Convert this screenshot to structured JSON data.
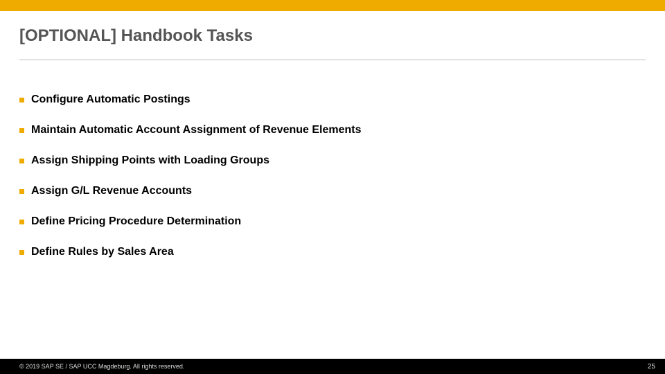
{
  "header": {
    "title": "[OPTIONAL] Handbook Tasks"
  },
  "bullets": {
    "items": [
      {
        "text": "Configure Automatic Postings"
      },
      {
        "text": "Maintain Automatic Account Assignment of Revenue Elements"
      },
      {
        "text": "Assign Shipping Points with Loading Groups"
      },
      {
        "text": "Assign G/L Revenue Accounts"
      },
      {
        "text": "Define Pricing Procedure Determination"
      },
      {
        "text": "Define Rules by Sales Area"
      }
    ]
  },
  "footer": {
    "copyright": "© 2019 SAP SE / SAP UCC Magdeburg. All rights reserved.",
    "page": "25"
  },
  "colors": {
    "accent": "#f0ab00"
  }
}
